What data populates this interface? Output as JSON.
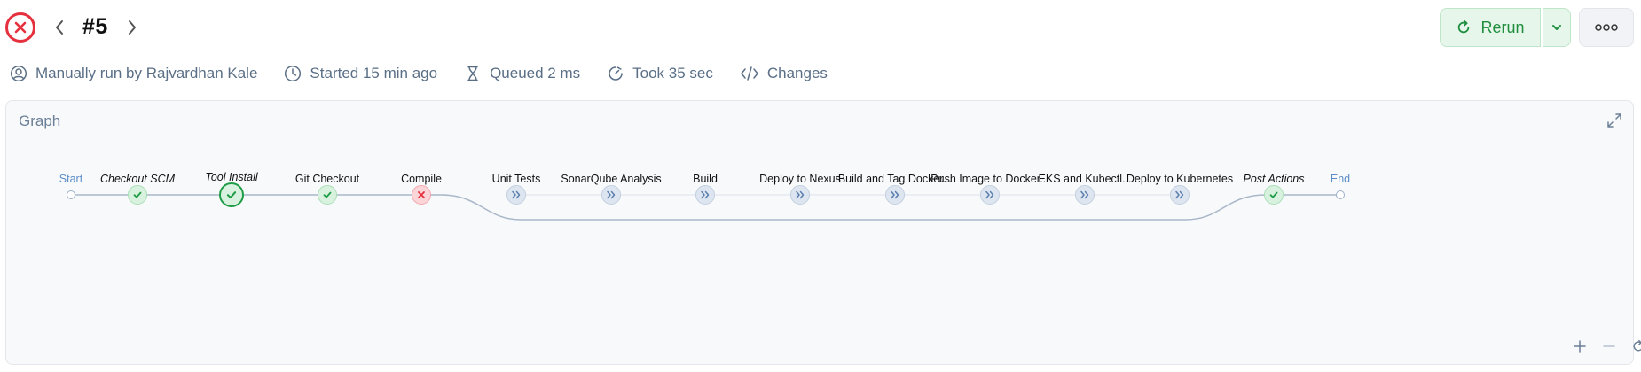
{
  "header": {
    "run_title": "#5",
    "rerun_label": "Rerun"
  },
  "meta": {
    "triggered_by": "Manually run by Rajvardhan Kale",
    "started": "Started 15 min ago",
    "queued": "Queued 2 ms",
    "took": "Took 35 sec",
    "changes": "Changes"
  },
  "graph": {
    "title": "Graph",
    "stages": [
      {
        "label": "Start",
        "status": "terminal"
      },
      {
        "label": "Checkout SCM",
        "status": "success"
      },
      {
        "label": "Tool Install",
        "status": "success-selected"
      },
      {
        "label": "Git Checkout",
        "status": "success"
      },
      {
        "label": "Compile",
        "status": "failed"
      },
      {
        "label": "Unit Tests",
        "status": "skipped"
      },
      {
        "label": "SonarQube Analysis",
        "status": "skipped"
      },
      {
        "label": "Build",
        "status": "skipped"
      },
      {
        "label": "Deploy to Nexus",
        "status": "skipped"
      },
      {
        "label": "Build and Tag Docker...",
        "status": "skipped"
      },
      {
        "label": "Push Image to Docker...",
        "status": "skipped"
      },
      {
        "label": "EKS and Kubectl...",
        "status": "skipped"
      },
      {
        "label": "Deploy to Kubernetes",
        "status": "skipped"
      },
      {
        "label": "Post Actions",
        "status": "success"
      },
      {
        "label": "End",
        "status": "terminal"
      }
    ]
  },
  "colors": {
    "failed": "#e5303e",
    "success": "#1f9d46",
    "skipped": "#5b7fae",
    "connector": "#a9b7c9"
  }
}
